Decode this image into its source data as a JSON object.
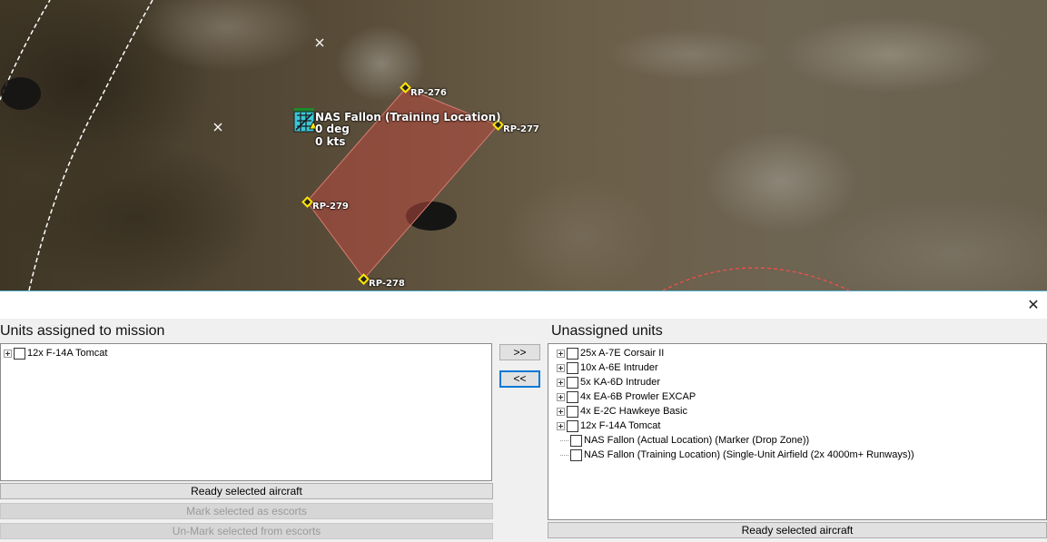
{
  "map": {
    "reference_points": [
      {
        "id": "rp-276",
        "label": "RP-276"
      },
      {
        "id": "rp-277",
        "label": "RP-277"
      },
      {
        "id": "rp-278",
        "label": "RP-278"
      },
      {
        "id": "rp-279",
        "label": "RP-279"
      }
    ],
    "unit": {
      "name": "NAS Fallon (Training Location)",
      "heading": "0 deg",
      "speed": "0 kts"
    },
    "colors": {
      "zone_fill": "#b84a40",
      "zone_stroke": "#d87a70",
      "rp_marker": "#ffe800",
      "range_ring": "#ff4c4c"
    }
  },
  "dialog": {
    "close_label": "✕",
    "assigned": {
      "heading": "Units assigned to mission",
      "items": [
        {
          "label": "12x F-14A Tomcat",
          "expandable": true
        }
      ],
      "buttons": {
        "ready": "Ready selected aircraft",
        "mark_escorts": "Mark selected as escorts",
        "unmark_escorts": "Un-Mark selected from escorts"
      }
    },
    "transfer": {
      "assign": ">>",
      "unassign": "<<"
    },
    "unassigned": {
      "heading": "Unassigned units",
      "items": [
        {
          "label": "25x A-7E Corsair II",
          "expandable": true
        },
        {
          "label": "10x A-6E Intruder",
          "expandable": true
        },
        {
          "label": "5x KA-6D Intruder",
          "expandable": true
        },
        {
          "label": "4x EA-6B Prowler EXCAP",
          "expandable": true
        },
        {
          "label": "4x E-2C Hawkeye Basic",
          "expandable": true
        },
        {
          "label": "12x F-14A Tomcat",
          "expandable": true
        },
        {
          "label": "NAS Fallon (Actual Location) (Marker (Drop Zone))",
          "expandable": false
        },
        {
          "label": "NAS Fallon (Training Location) (Single-Unit Airfield (2x 4000m+ Runways))",
          "expandable": false
        }
      ],
      "buttons": {
        "ready": "Ready selected aircraft"
      }
    }
  }
}
